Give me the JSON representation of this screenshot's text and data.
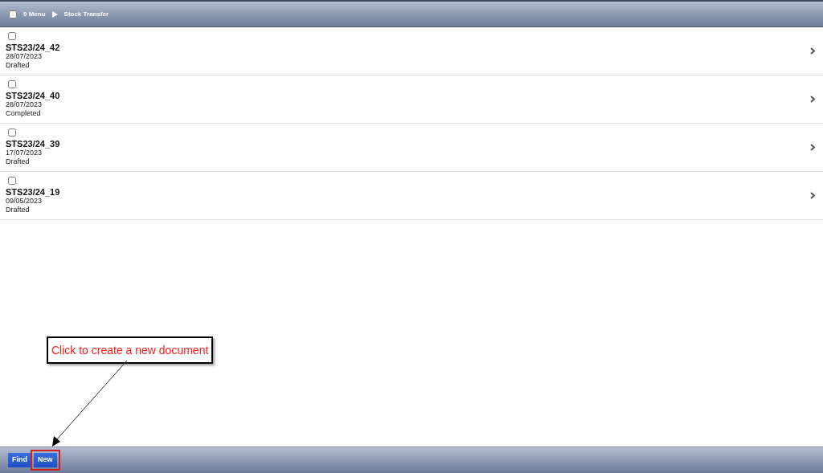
{
  "header": {
    "select_all": {
      "checked": false
    },
    "menu_label": "0 Menu",
    "breadcrumb": "Stock Transfer"
  },
  "rows": [
    {
      "checked": false,
      "number": "STS23/24_42",
      "date": "28/07/2023",
      "status": "Drafted"
    },
    {
      "checked": false,
      "number": "STS23/24_40",
      "date": "28/07/2023",
      "status": "Completed"
    },
    {
      "checked": false,
      "number": "STS23/24_39",
      "date": "17/07/2023",
      "status": "Drafted"
    },
    {
      "checked": false,
      "number": "STS23/24_19",
      "date": "09/05/2023",
      "status": "Drafted"
    }
  ],
  "footer": {
    "buttons": [
      {
        "label": "Find",
        "highlighted": false
      },
      {
        "label": "New",
        "highlighted": true
      }
    ]
  },
  "callout": {
    "text": "Click to create a new document"
  }
}
